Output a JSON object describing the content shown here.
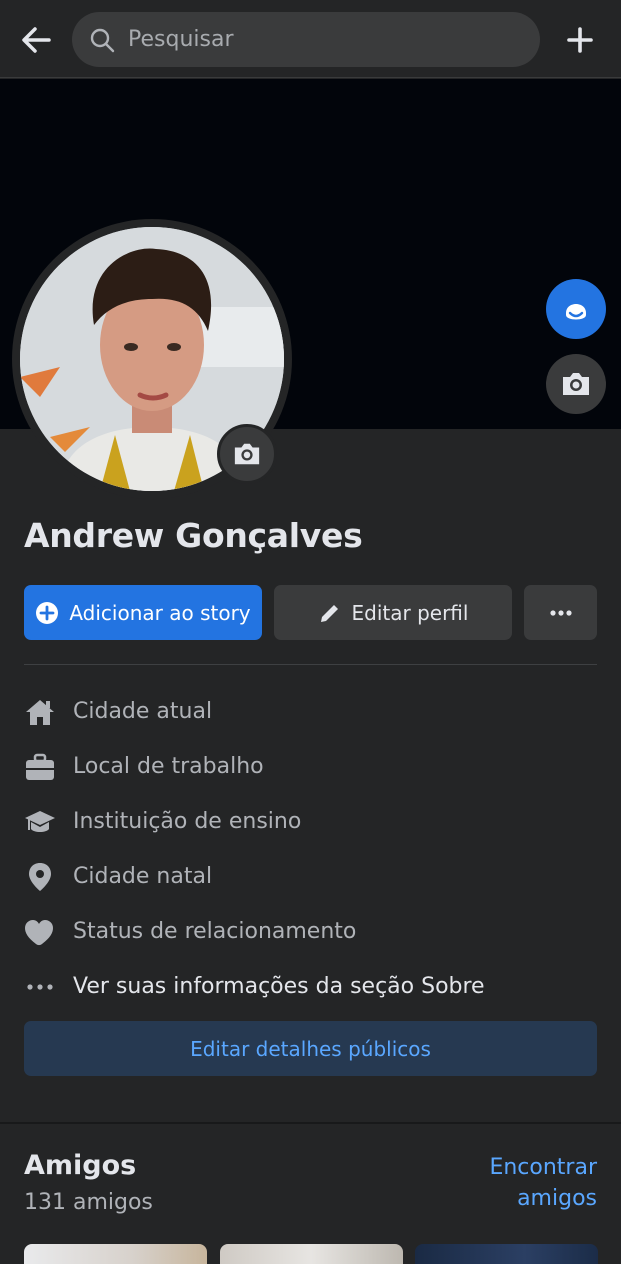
{
  "topbar": {
    "search_placeholder": "Pesquisar",
    "back_icon": "arrow-left-icon",
    "add_icon": "plus-icon"
  },
  "profile": {
    "name": "Andrew Gonçalves"
  },
  "actions": {
    "add_story": "Adicionar ao story",
    "edit_profile": "Editar perfil",
    "more": "more-dots-icon"
  },
  "info": {
    "items": [
      {
        "label": "Cidade atual",
        "icon": "home-icon"
      },
      {
        "label": "Local de trabalho",
        "icon": "briefcase-icon"
      },
      {
        "label": "Instituição de ensino",
        "icon": "graduation-cap-icon"
      },
      {
        "label": "Cidade natal",
        "icon": "location-pin-icon"
      },
      {
        "label": "Status de relacionamento",
        "icon": "heart-icon"
      },
      {
        "label": "Ver suas informações da seção Sobre",
        "icon": "ellipsis-icon"
      }
    ]
  },
  "public_details_button": "Editar detalhes públicos",
  "friends": {
    "title": "Amigos",
    "count": "131 amigos",
    "find": "Encontrar amigos"
  },
  "colors": {
    "accent": "#2374e1",
    "background": "#242526",
    "cover": "#02050b",
    "link": "#5aa7ff"
  }
}
